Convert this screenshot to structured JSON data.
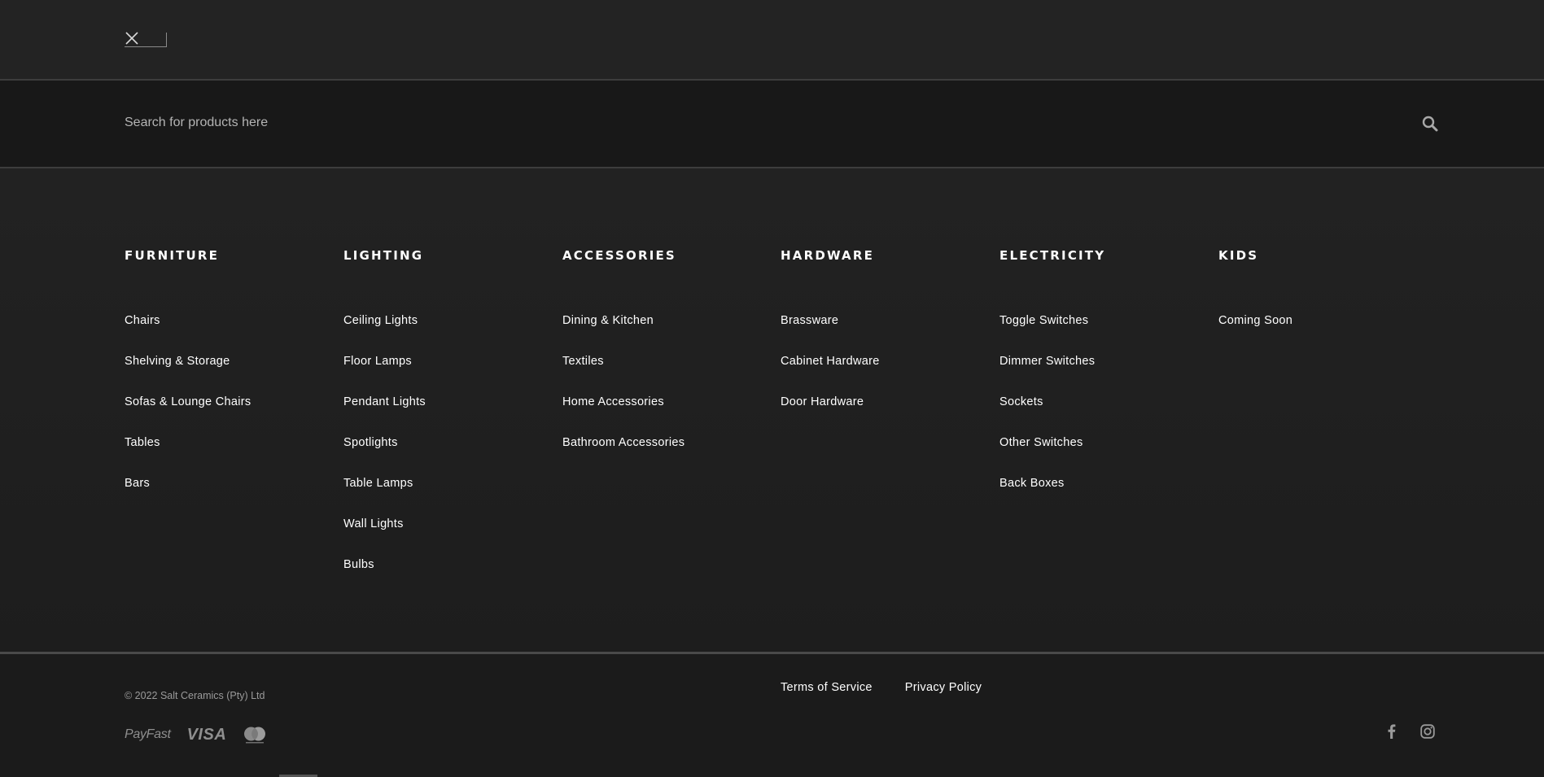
{
  "header": {
    "close_label": "Close menu"
  },
  "search": {
    "placeholder": "Search for products here"
  },
  "menu": {
    "columns": [
      {
        "title": "FURNITURE",
        "items": [
          "Chairs",
          "Shelving & Storage",
          "Sofas & Lounge Chairs",
          "Tables",
          "Bars"
        ]
      },
      {
        "title": "LIGHTING",
        "items": [
          "Ceiling Lights",
          "Floor Lamps",
          "Pendant Lights",
          "Spotlights",
          "Table Lamps",
          "Wall Lights",
          "Bulbs"
        ]
      },
      {
        "title": "ACCESSORIES",
        "items": [
          "Dining & Kitchen",
          "Textiles",
          "Home Accessories",
          "Bathroom Accessories"
        ]
      },
      {
        "title": "HARDWARE",
        "items": [
          "Brassware",
          "Cabinet Hardware",
          "Door Hardware"
        ]
      },
      {
        "title": "ELECTRICITY",
        "items": [
          "Toggle Switches",
          "Dimmer Switches",
          "Sockets",
          "Other Switches",
          "Back Boxes"
        ]
      },
      {
        "title": "KIDS",
        "items": [
          "Coming Soon"
        ]
      }
    ]
  },
  "footer": {
    "copyright": "© 2022 Salt Ceramics (Pty) Ltd",
    "legal_links": [
      "Terms of Service",
      "Privacy Policy"
    ],
    "payments": {
      "payfast": "PayFast",
      "visa": "VISA",
      "mastercard_icon": "mastercard-icon"
    },
    "social_icons": [
      "facebook-icon",
      "instagram-icon"
    ]
  },
  "colors": {
    "background": "#222222",
    "search_background": "#181818",
    "text": "#ffffff",
    "muted_text": "#9a9a9a",
    "divider": "#4a4a4a"
  }
}
